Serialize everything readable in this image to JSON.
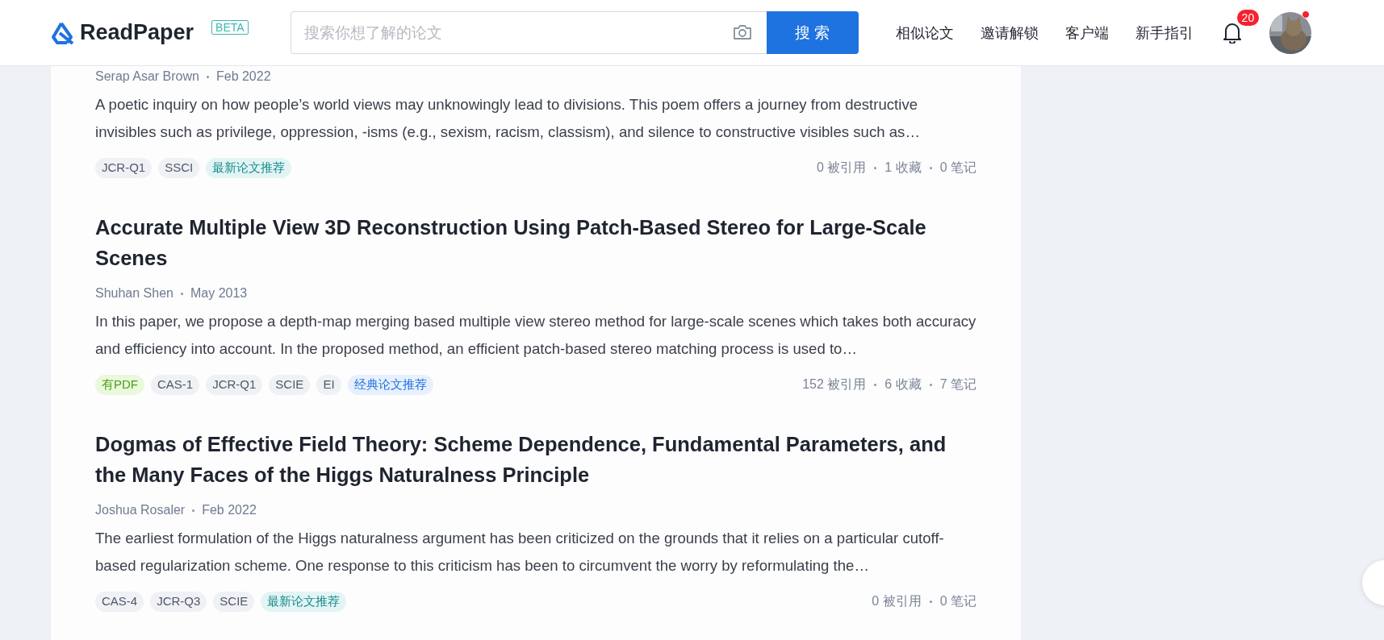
{
  "header": {
    "logo": "ReadPaper",
    "beta": "BETA",
    "search": {
      "placeholder": "搜索你想了解的论文",
      "button": "搜 索"
    },
    "nav": [
      "相似论文",
      "邀请解锁",
      "客户端",
      "新手指引"
    ],
    "notifications": "20",
    "avatar_dot": true
  },
  "papers": [
    {
      "author": "Serap Asar Brown",
      "date": "Feb 2022",
      "abstract": "A poetic inquiry on how people’s world views may unknowingly lead to divisions. This poem offers a journey from destructive invisibles such as privilege, oppression, -isms (e.g., sexism, racism, classism), and silence to constructive visibles such as…",
      "tags": [
        {
          "label": "JCR-Q1",
          "kind": "plain"
        },
        {
          "label": "SSCI",
          "kind": "plain"
        },
        {
          "label": "最新论文推荐",
          "kind": "new"
        }
      ],
      "stats": [
        "0 被引用",
        "1 收藏",
        "0 笔记"
      ]
    },
    {
      "title": "Accurate Multiple View 3D Reconstruction Using Patch-Based Stereo for Large-Scale Scenes",
      "author": "Shuhan Shen",
      "date": "May 2013",
      "abstract": "In this paper, we propose a depth-map merging based multiple view stereo method for large-scale scenes which takes both accuracy and efficiency into account. In the proposed method, an efficient patch-based stereo matching process is used to…",
      "tags": [
        {
          "label": "有PDF",
          "kind": "pdf"
        },
        {
          "label": "CAS-1",
          "kind": "plain"
        },
        {
          "label": "JCR-Q1",
          "kind": "plain"
        },
        {
          "label": "SCIE",
          "kind": "plain"
        },
        {
          "label": "EI",
          "kind": "plain"
        },
        {
          "label": "经典论文推荐",
          "kind": "classic"
        }
      ],
      "stats": [
        "152 被引用",
        "6 收藏",
        "7 笔记"
      ]
    },
    {
      "title": "Dogmas of Effective Field Theory: Scheme Dependence, Fundamental Parameters, and the Many Faces of the Higgs Naturalness Principle",
      "author": "Joshua Rosaler",
      "date": "Feb 2022",
      "abstract": "The earliest formulation of the Higgs naturalness argument has been criticized on the grounds that it relies on a particular cutoff-based regularization scheme. One response to this criticism has been to circumvent the worry by reformulating the…",
      "tags": [
        {
          "label": "CAS-4",
          "kind": "plain"
        },
        {
          "label": "JCR-Q3",
          "kind": "plain"
        },
        {
          "label": "SCIE",
          "kind": "plain"
        },
        {
          "label": "最新论文推荐",
          "kind": "new"
        }
      ],
      "stats": [
        "0 被引用",
        "0 笔记"
      ]
    }
  ]
}
